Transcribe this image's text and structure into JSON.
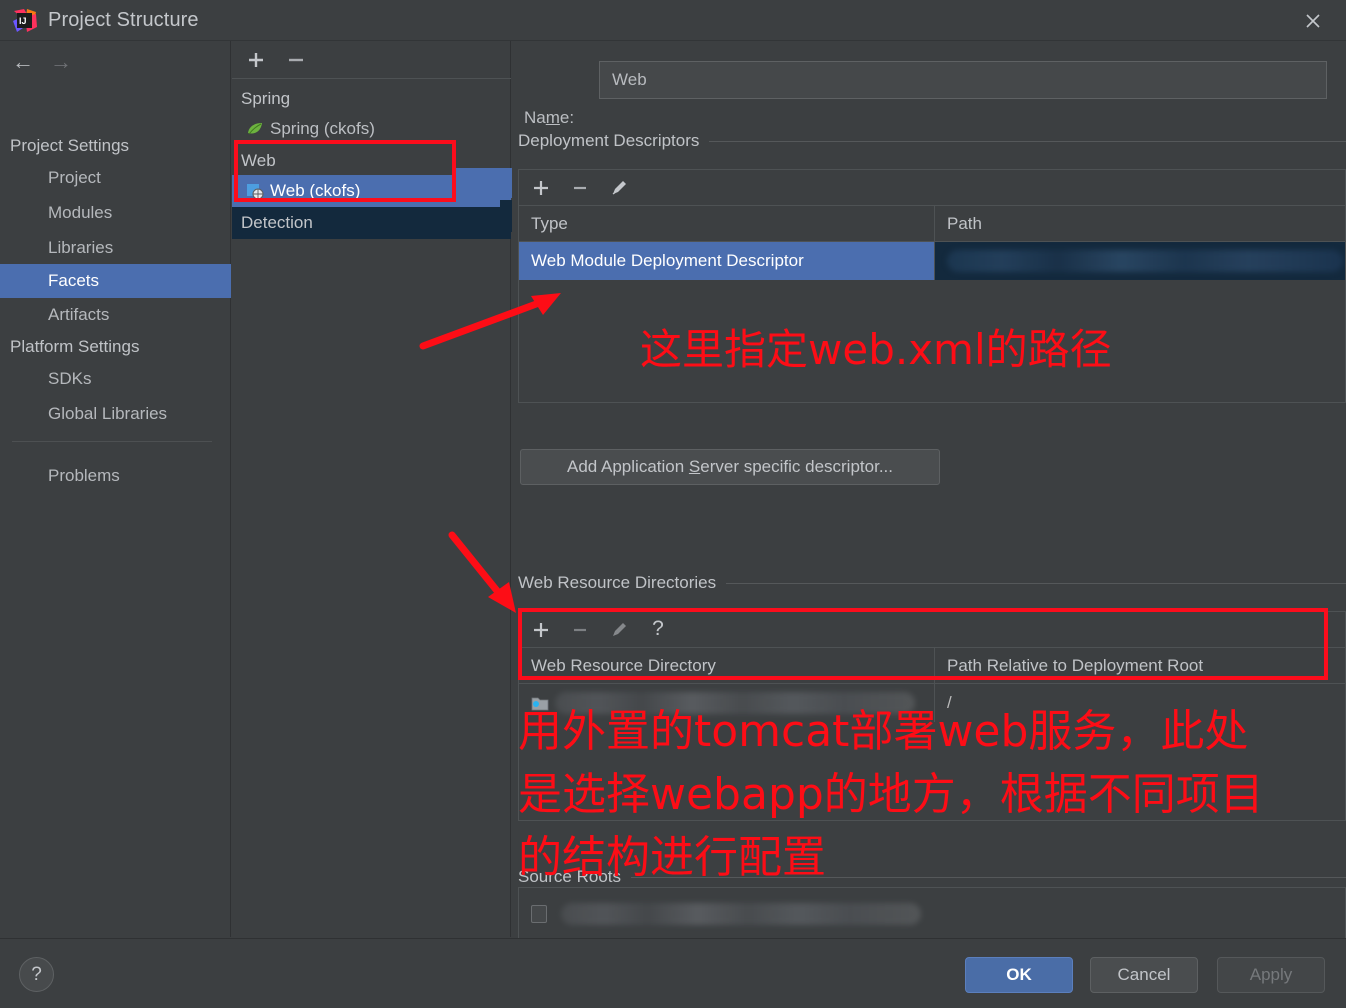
{
  "window": {
    "title": "Project Structure",
    "logo_icon": "intellij-idea-logo",
    "close_icon": "close-icon"
  },
  "nav": {
    "back_icon": "arrow-left-icon",
    "forward_icon": "arrow-right-icon",
    "groups": [
      {
        "label": "Project Settings"
      },
      {
        "label": "Platform Settings"
      }
    ],
    "items": [
      {
        "label": "Project",
        "selected": false
      },
      {
        "label": "Modules",
        "selected": false
      },
      {
        "label": "Libraries",
        "selected": false
      },
      {
        "label": "Facets",
        "selected": true
      },
      {
        "label": "Artifacts",
        "selected": false
      },
      {
        "label": "SDKs",
        "selected": false
      },
      {
        "label": "Global Libraries",
        "selected": false
      },
      {
        "label": "Problems",
        "selected": false
      }
    ]
  },
  "tree": {
    "toolbar": {
      "add_icon": "plus-icon",
      "remove_icon": "minus-icon"
    },
    "groups": [
      {
        "label": "Spring"
      },
      {
        "label": "Web"
      },
      {
        "label": "Detection"
      }
    ],
    "nodes": [
      {
        "label": "Spring (ckofs)",
        "icon": "spring-leaf-icon",
        "selected": false
      },
      {
        "label": "Web (ckofs)",
        "icon": "web-facet-icon",
        "selected": true
      }
    ]
  },
  "facet": {
    "name_label": "Na",
    "name_label_mnemonic": "m",
    "name_label_tail": "e:",
    "name_value": "Web",
    "name_placeholder": ""
  },
  "deployment_descriptors": {
    "section_title": "Deployment Descriptors",
    "toolbar": {
      "add_icon": "plus-icon",
      "remove_icon": "minus-icon",
      "edit_icon": "pencil-icon"
    },
    "columns": [
      "Type",
      "Path"
    ],
    "rows": [
      {
        "type": "Web Module Deployment Descriptor",
        "path": "",
        "path_redacted": true,
        "selected": true
      }
    ],
    "add_descriptor_button": {
      "prefix": "Add Application ",
      "mnemonic": "S",
      "suffix": "erver specific descriptor..."
    }
  },
  "web_resource_directories": {
    "section_title": "Web Resource Directories",
    "toolbar": {
      "add_icon": "plus-icon",
      "remove_icon": "minus-icon",
      "edit_icon": "pencil-icon",
      "help_icon": "question-mark-icon"
    },
    "columns": [
      "Web Resource Directory",
      "Path Relative to Deployment Root"
    ],
    "rows": [
      {
        "directory": "",
        "directory_redacted": true,
        "directory_icon": "folder-icon",
        "relative_path": "/"
      }
    ]
  },
  "source_roots": {
    "section_title": "Source Roots",
    "rows": [
      {
        "checked": false,
        "label": "",
        "redacted": true
      }
    ]
  },
  "annotations": [
    {
      "id": "anno-1",
      "text": "这里指定web.xml的路径",
      "color": "#fd0d16"
    },
    {
      "id": "anno-2",
      "text": "用外置的tomcat部署web服务，此处\n是选择webapp的地方，根据不同项目\n的结构进行配置",
      "color": "#fd0d16"
    }
  ],
  "highlights": {
    "color": "#fc0d1c",
    "boxes": [
      "tree-web-facet-box",
      "web-resource-directory-box"
    ],
    "arrows": [
      "arrow-to-deployment-descriptor",
      "arrow-to-web-resource-directory"
    ]
  },
  "footer": {
    "help_label": "?",
    "ok_label": "OK",
    "cancel_label": "Cancel",
    "apply_label": "Apply",
    "apply_enabled": false
  },
  "colors": {
    "background": "#3c3f41",
    "selection_blue": "#4b6eaf",
    "group_navy": "#13293d",
    "annotation_red": "#fd0d16",
    "ok_button": "#4a6da7"
  }
}
